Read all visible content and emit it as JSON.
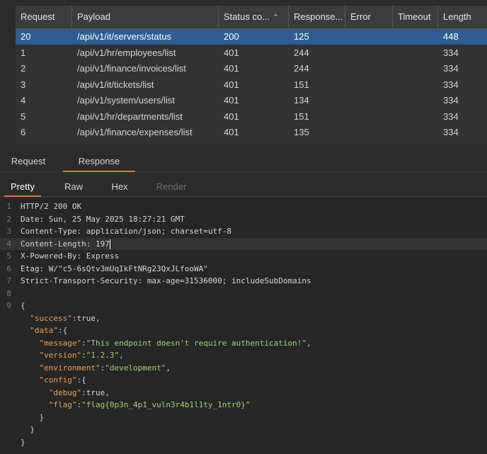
{
  "table": {
    "columns": [
      {
        "key": "request",
        "label": "Request"
      },
      {
        "key": "payload",
        "label": "Payload"
      },
      {
        "key": "status",
        "label": "Status co..."
      },
      {
        "key": "response",
        "label": "Response..."
      },
      {
        "key": "error",
        "label": "Error"
      },
      {
        "key": "timeout",
        "label": "Timeout"
      },
      {
        "key": "length",
        "label": "Length"
      }
    ],
    "sort_indicator": "^",
    "rows": [
      {
        "request": "20",
        "payload": "/api/v1/it/servers/status",
        "status": "200",
        "response": "125",
        "error": "",
        "timeout": "",
        "length": "448",
        "selected": true
      },
      {
        "request": "1",
        "payload": "/api/v1/hr/employees/list",
        "status": "401",
        "response": "244",
        "error": "",
        "timeout": "",
        "length": "334"
      },
      {
        "request": "2",
        "payload": "/api/v1/finance/invoices/list",
        "status": "401",
        "response": "244",
        "error": "",
        "timeout": "",
        "length": "334"
      },
      {
        "request": "3",
        "payload": "/api/v1/it/tickets/list",
        "status": "401",
        "response": "151",
        "error": "",
        "timeout": "",
        "length": "334"
      },
      {
        "request": "4",
        "payload": "/api/v1/system/users/list",
        "status": "401",
        "response": "134",
        "error": "",
        "timeout": "",
        "length": "334"
      },
      {
        "request": "5",
        "payload": "/api/v1/hr/departments/list",
        "status": "401",
        "response": "151",
        "error": "",
        "timeout": "",
        "length": "334"
      },
      {
        "request": "6",
        "payload": "/api/v1/finance/expenses/list",
        "status": "401",
        "response": "135",
        "error": "",
        "timeout": "",
        "length": "334"
      }
    ]
  },
  "tabs": {
    "request": "Request",
    "response": "Response"
  },
  "subtabs": {
    "pretty": "Pretty",
    "raw": "Raw",
    "hex": "Hex",
    "render": "Render"
  },
  "editor": {
    "lines": [
      {
        "n": "1",
        "parts": [
          {
            "c": "k-hdr",
            "t": "HTTP/2 200 OK"
          }
        ]
      },
      {
        "n": "2",
        "parts": [
          {
            "c": "k-hdr",
            "t": "Date: Sun, 25 May 2025 18:27:21 GMT"
          }
        ]
      },
      {
        "n": "3",
        "parts": [
          {
            "c": "k-hdr",
            "t": "Content-Type: application/json; charset=utf-8"
          }
        ]
      },
      {
        "n": "4",
        "parts": [
          {
            "c": "k-hdr",
            "t": "Content-Length: 197"
          }
        ],
        "current": true
      },
      {
        "n": "5",
        "parts": [
          {
            "c": "k-hdr",
            "t": "X-Powered-By: Express"
          }
        ]
      },
      {
        "n": "6",
        "parts": [
          {
            "c": "k-hdr",
            "t": "Etag: W/\"c5-6sQtv3mUqIkFtNRg23QxJLfooWA\""
          }
        ]
      },
      {
        "n": "7",
        "parts": [
          {
            "c": "k-hdr",
            "t": "Strict-Transport-Security: max-age=31536000; includeSubDomains"
          }
        ]
      },
      {
        "n": "8",
        "parts": []
      },
      {
        "n": "9",
        "parts": [
          {
            "c": "k-val",
            "t": "{"
          }
        ]
      },
      {
        "n": "",
        "parts": [
          {
            "c": "k-val",
            "t": "  "
          },
          {
            "c": "k-key",
            "t": "\"success\""
          },
          {
            "c": "k-val",
            "t": ":true,"
          }
        ]
      },
      {
        "n": "",
        "parts": [
          {
            "c": "k-val",
            "t": "  "
          },
          {
            "c": "k-key",
            "t": "\"data\""
          },
          {
            "c": "k-val",
            "t": ":{"
          }
        ]
      },
      {
        "n": "",
        "parts": [
          {
            "c": "k-val",
            "t": "    "
          },
          {
            "c": "k-key",
            "t": "\"message\""
          },
          {
            "c": "k-val",
            "t": ":"
          },
          {
            "c": "k-str",
            "t": "\"This endpoint doesn't require authentication!\""
          },
          {
            "c": "k-val",
            "t": ","
          }
        ]
      },
      {
        "n": "",
        "parts": [
          {
            "c": "k-val",
            "t": "    "
          },
          {
            "c": "k-key",
            "t": "\"version\""
          },
          {
            "c": "k-val",
            "t": ":"
          },
          {
            "c": "k-str",
            "t": "\"1.2.3\""
          },
          {
            "c": "k-val",
            "t": ","
          }
        ]
      },
      {
        "n": "",
        "parts": [
          {
            "c": "k-val",
            "t": "    "
          },
          {
            "c": "k-key",
            "t": "\"environment\""
          },
          {
            "c": "k-val",
            "t": ":"
          },
          {
            "c": "k-str",
            "t": "\"development\""
          },
          {
            "c": "k-val",
            "t": ","
          }
        ]
      },
      {
        "n": "",
        "parts": [
          {
            "c": "k-val",
            "t": "    "
          },
          {
            "c": "k-key",
            "t": "\"config\""
          },
          {
            "c": "k-val",
            "t": ":{"
          }
        ]
      },
      {
        "n": "",
        "parts": [
          {
            "c": "k-val",
            "t": "      "
          },
          {
            "c": "k-key",
            "t": "\"debug\""
          },
          {
            "c": "k-val",
            "t": ":true,"
          }
        ]
      },
      {
        "n": "",
        "parts": [
          {
            "c": "k-val",
            "t": "      "
          },
          {
            "c": "k-key",
            "t": "\"flag\""
          },
          {
            "c": "k-val",
            "t": ":"
          },
          {
            "c": "k-str",
            "t": "\"flag{0p3n_4p1_vuln3r4b1l1ty_1ntr0}\""
          }
        ]
      },
      {
        "n": "",
        "parts": [
          {
            "c": "k-val",
            "t": "    }"
          }
        ]
      },
      {
        "n": "",
        "parts": [
          {
            "c": "k-val",
            "t": "  }"
          }
        ]
      },
      {
        "n": "",
        "parts": [
          {
            "c": "k-val",
            "t": "}"
          }
        ]
      }
    ]
  },
  "colors": {
    "accent": "#e8743b",
    "selection": "#2e5d91",
    "json_key": "#f0a04b",
    "json_string": "#9fd56b"
  }
}
